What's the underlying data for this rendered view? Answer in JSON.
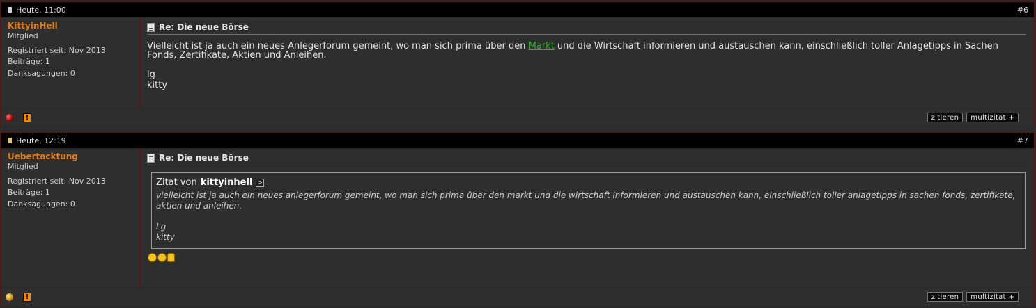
{
  "posts": [
    {
      "date": "Heute, 11:00",
      "number": "#6",
      "user": {
        "name": "KittyinHell",
        "rank": "Mitglied",
        "registered": "Registriert seit: Nov 2013",
        "posts": "Beiträge: 1",
        "thanks": "Danksagungen: 0"
      },
      "title": "Re: Die neue Börse",
      "message": {
        "before_link": "Vielleicht ist ja auch ein neues Anlegerforum gemeint, wo man sich prima über den ",
        "link": "Markt",
        "after_link": " und die Wirtschaft informieren und austauschen kann, einschließlich toller Anlagetipps in Sachen Fonds, Zertifikate, Aktien und Anleihen.",
        "line2": "lg",
        "line3": "kitty"
      },
      "buttons": {
        "quote": "zitieren",
        "multiquote": "multizitat +"
      }
    },
    {
      "date": "Heute, 12:19",
      "number": "#7",
      "user": {
        "name": "Uebertacktung",
        "rank": "Mitglied",
        "registered": "Registriert seit: Nov 2013",
        "posts": "Beiträge: 1",
        "thanks": "Danksagungen: 0"
      },
      "title": "Re: Die neue Börse",
      "quote": {
        "prefix": "Zitat von",
        "author": "kittyinhell",
        "text": "vielleicht ist ja auch ein neues anlegerforum gemeint, wo man sich prima über den markt und die wirtschaft informieren und austauschen kann, einschließlich toller anlagetipps in sachen fonds, zertifikate, aktien und anleihen.",
        "line2": "Lg",
        "line3": "kitty"
      },
      "buttons": {
        "quote": "zitieren",
        "multiquote": "multizitat +"
      }
    }
  ],
  "icons": [
    "page-icon",
    "post-title-icon",
    "quote-arrow-icon",
    "online-status-icon",
    "report-icon",
    "smiley-icon",
    "thumbs-up-icon"
  ],
  "colors": {
    "username": "#e07a12",
    "link": "#2bb32b",
    "border": "#5a1414",
    "header": "#000000"
  }
}
